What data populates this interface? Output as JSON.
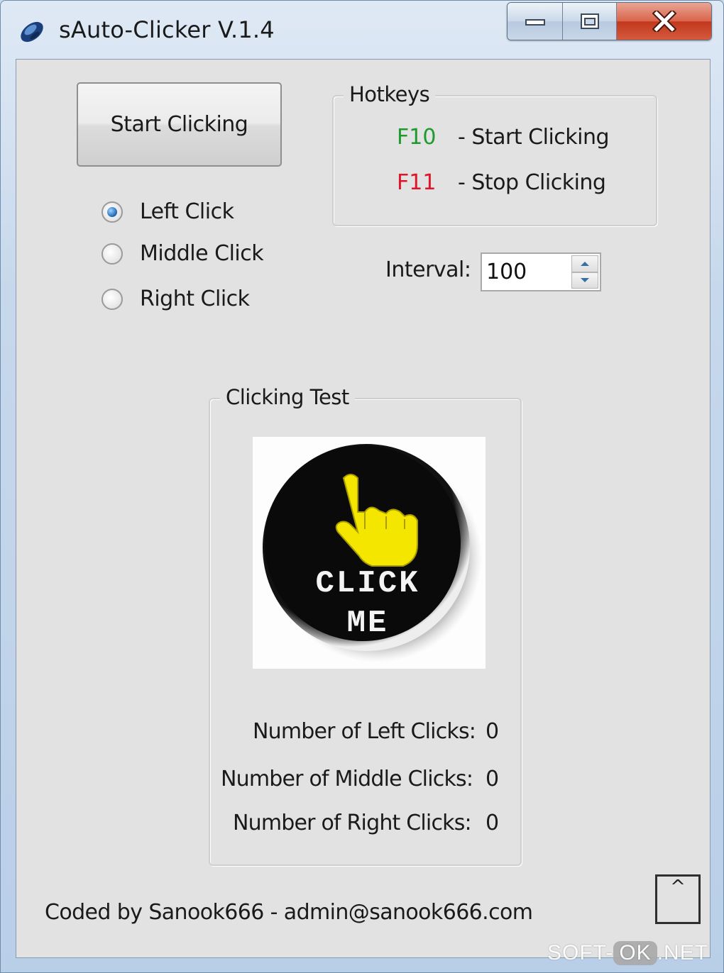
{
  "window": {
    "title": "sAuto-Clicker V.1.4"
  },
  "controls": {
    "start_button_label": "Start Clicking",
    "radios": [
      {
        "label": "Left Click",
        "selected": true
      },
      {
        "label": "Middle Click",
        "selected": false
      },
      {
        "label": "Right Click",
        "selected": false
      }
    ]
  },
  "hotkeys": {
    "group_title": "Hotkeys",
    "items": [
      {
        "key": "F10",
        "desc": "- Start Clicking",
        "color": "#1f9a2c"
      },
      {
        "key": "F11",
        "desc": "- Stop Clicking",
        "color": "#e0142a"
      }
    ]
  },
  "interval": {
    "label": "Interval:",
    "value": "100"
  },
  "clicking_test": {
    "group_title": "Clicking Test",
    "image_text_line1": "CLICK",
    "image_text_line2": "ME",
    "counters": [
      {
        "label": "Number of Left Clicks:",
        "value": "0"
      },
      {
        "label": "Number of Middle Clicks:",
        "value": "0"
      },
      {
        "label": "Number of Right Clicks:",
        "value": "0"
      }
    ]
  },
  "footer": {
    "credit": "Coded by Sanook666 - admin@sanook666.com",
    "up_button_label": "^"
  },
  "watermark": {
    "part1": "SOFT-",
    "part2": "OK",
    "part3": ".NET"
  },
  "colors": {
    "hand_yellow": "#f5e600",
    "button_black": "#0a0a0a",
    "close_red": "#c9422a"
  }
}
